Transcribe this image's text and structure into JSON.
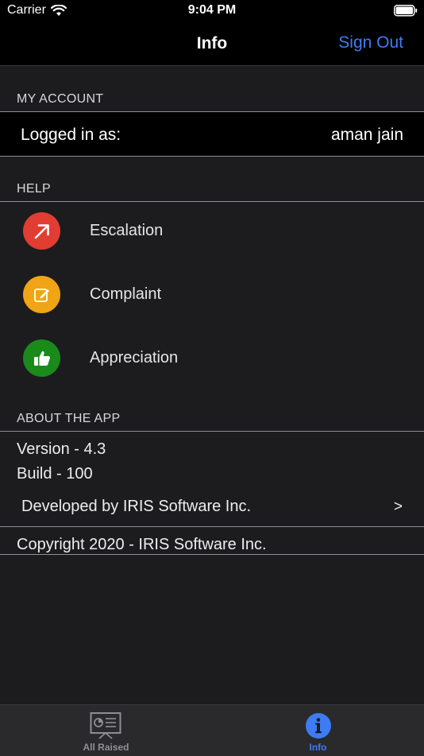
{
  "status_bar": {
    "carrier": "Carrier",
    "time": "9:04 PM"
  },
  "nav": {
    "title": "Info",
    "sign_out": "Sign Out"
  },
  "my_account": {
    "header": "MY ACCOUNT",
    "logged_in_label": "Logged in as:",
    "logged_in_value": "aman jain"
  },
  "help": {
    "header": "HELP",
    "items": [
      {
        "label": "Escalation",
        "icon": "arrow-up-right-icon",
        "color": "#e13d32"
      },
      {
        "label": "Complaint",
        "icon": "edit-note-icon",
        "color": "#f0a516"
      },
      {
        "label": "Appreciation",
        "icon": "thumbs-up-icon",
        "color": "#1a8a1a"
      }
    ]
  },
  "about": {
    "header": "ABOUT THE APP",
    "version": "Version - 4.3",
    "build": "Build - 100",
    "developed_by": "Developed by IRIS Software Inc.",
    "chevron": ">",
    "copyright": "Copyright 2020 - IRIS Software Inc."
  },
  "tabs": [
    {
      "label": "All Raised",
      "icon": "presentation-icon",
      "active": false
    },
    {
      "label": "Info",
      "icon": "info-icon",
      "active": true
    }
  ],
  "colors": {
    "accent": "#3d7cf5",
    "tab_inactive": "#8e8e93"
  }
}
